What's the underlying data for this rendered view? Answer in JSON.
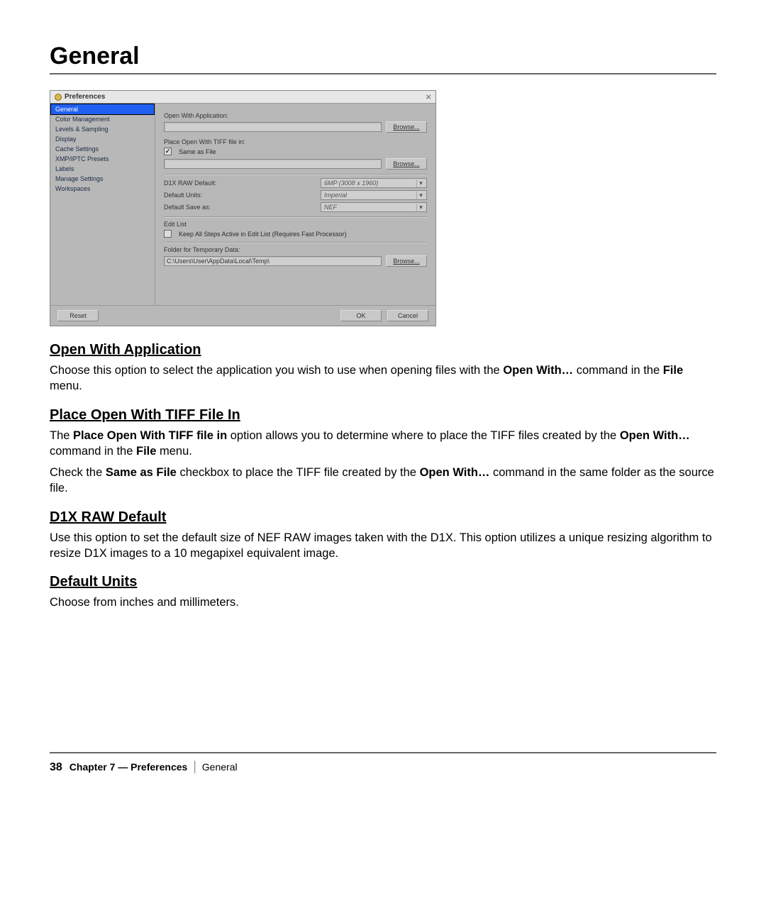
{
  "page_title": "General",
  "dialog": {
    "title": "Preferences",
    "close_glyph": "×",
    "sidebar": {
      "items": [
        "General",
        "Color Management",
        "Levels & Sampling",
        "Display",
        "Cache Settings",
        "XMP/IPTC Presets",
        "Labels",
        "Manage Settings",
        "Workspaces"
      ],
      "selected_index": 0
    },
    "main": {
      "open_with_app_label": "Open With Application:",
      "open_with_app_value": "",
      "browse_label": "Browse...",
      "place_tiff_label": "Place Open With TIFF file in:",
      "same_as_file_checked": true,
      "same_as_file_label": "Same as File",
      "place_tiff_path_value": "",
      "d1x_label": "D1X RAW Default:",
      "d1x_value": "6MP (3008 x 1960)",
      "units_label": "Default Units:",
      "units_value": "Imperial",
      "saveas_label": "Default Save as:",
      "saveas_value": "NEF",
      "editlist_label": "Edit List",
      "keep_steps_label": "Keep All Steps Active in Edit List (Requires Fast Processor)",
      "keep_steps_checked": false,
      "temp_folder_label": "Folder for Temporary Data:",
      "temp_folder_value": "C:\\Users\\User\\AppData\\Local\\Temp\\"
    },
    "buttons": {
      "reset": "Reset",
      "ok": "OK",
      "cancel": "Cancel"
    }
  },
  "doc": {
    "s1_heading": "Open With Application",
    "s1_p1_a": "Choose this option to select the application you wish to use when opening files with the ",
    "s1_p1_b": "Open With…",
    "s1_p1_c": " command in the ",
    "s1_p1_d": "File",
    "s1_p1_e": " menu.",
    "s2_heading": "Place Open With TIFF File In",
    "s2_p1_a": "The ",
    "s2_p1_b": "Place Open With TIFF file in",
    "s2_p1_c": " option allows you to determine where to place the TIFF files created by the ",
    "s2_p1_d": "Open With…",
    "s2_p1_e": " command in the ",
    "s2_p1_f": "File",
    "s2_p1_g": " menu.",
    "s2_p2_a": "Check the ",
    "s2_p2_b": "Same as File",
    "s2_p2_c": " checkbox to place the TIFF file created by the ",
    "s2_p2_d": "Open With…",
    "s2_p2_e": " command in the same folder as the source file.",
    "s3_heading": "D1X RAW Default",
    "s3_p1": "Use this option to set the default size of NEF RAW images taken with the D1X. This option utilizes a unique resizing algorithm to resize D1X images to a 10 megapixel equivalent image.",
    "s4_heading": "Default Units",
    "s4_p1": "Choose from inches and millimeters."
  },
  "footer": {
    "page": "38",
    "chapter": "Chapter 7 — Preferences",
    "section": "General"
  }
}
